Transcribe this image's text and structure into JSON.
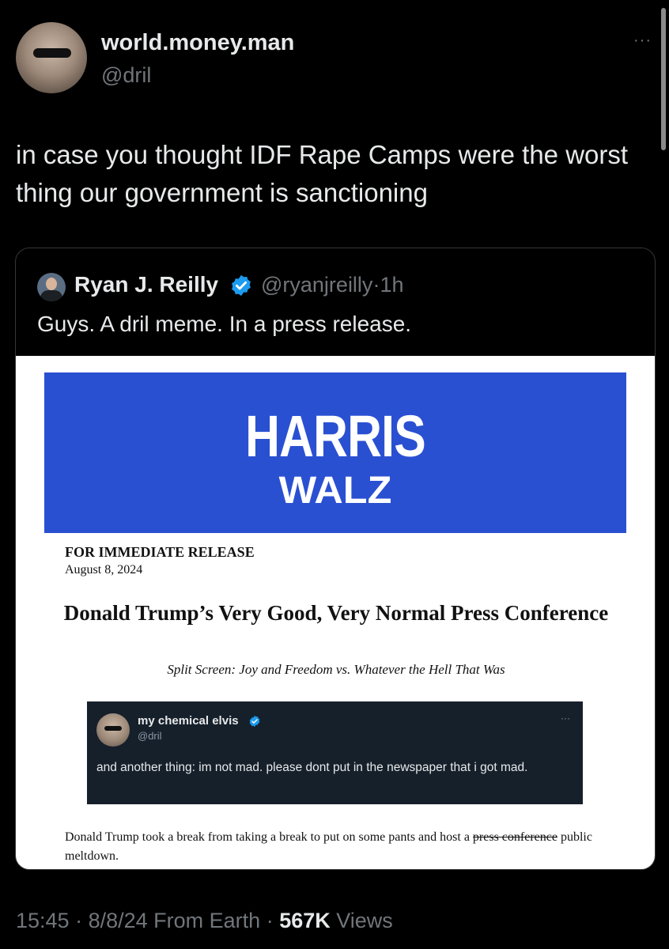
{
  "tweet": {
    "user_name": "world.money.man",
    "user_handle": "@dril",
    "more_label": "···",
    "text": "in case you thought IDF Rape Camps were the worst thing our government is sanctioning"
  },
  "quote": {
    "name": "Ryan J. Reilly",
    "handle": "@ryanjreilly",
    "separator": "·",
    "time": "1h",
    "text": "Guys. A dril meme. In a press release."
  },
  "release": {
    "banner_line1": "HARRIS",
    "banner_line2": "WALZ",
    "label": "FOR IMMEDIATE RELEASE",
    "date": "August 8, 2024",
    "title": "Donald Trump’s Very Good, Very Normal Press Conference",
    "subtitle": "Split Screen: Joy and Freedom vs. Whatever the Hell That Was",
    "body_before": "Donald Trump took a break from taking a break to put on some pants and host a",
    "body_struck": "press conference",
    "body_after": "public meltdown."
  },
  "embedded_tweet": {
    "name": "my chemical elvis",
    "handle": "@dril",
    "more_label": "···",
    "text": "and another thing: im not mad. please dont put in the newspaper that i got mad."
  },
  "footer": {
    "time": "15:45",
    "sep1": " · ",
    "date": "8/8/24",
    "source": " From Earth",
    "sep2": " · ",
    "views_count": "567K",
    "views_label": " Views"
  },
  "colors": {
    "verified": "#1d9bf0",
    "banner_blue": "#2a50d2",
    "muted": "#71767b"
  },
  "icons": [
    "verified-badge-icon",
    "more-options-icon"
  ]
}
